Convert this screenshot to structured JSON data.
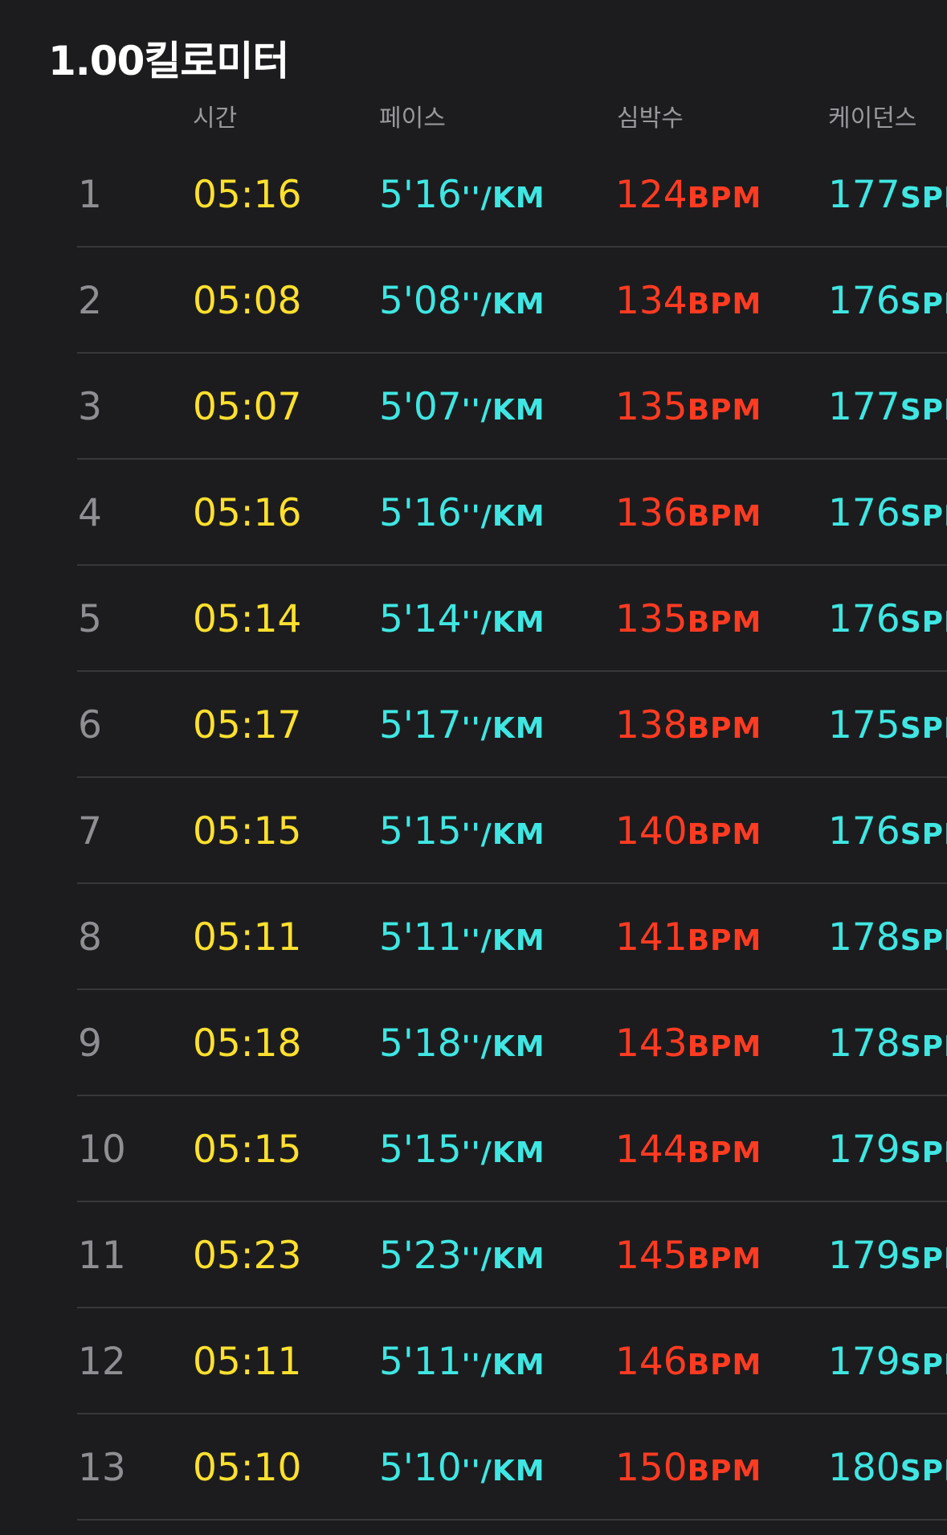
{
  "title": "1.00킬로미터",
  "columns": {
    "time": "시간",
    "pace": "페이스",
    "heart_rate": "심박수",
    "cadence": "케이던스"
  },
  "units": {
    "pace": "''/KM",
    "heart_rate": "BPM",
    "cadence": "SPM"
  },
  "rows": [
    {
      "index": "1",
      "time": "05:16",
      "pace": "5'16",
      "hr": "124",
      "cadence": "177"
    },
    {
      "index": "2",
      "time": "05:08",
      "pace": "5'08",
      "hr": "134",
      "cadence": "176"
    },
    {
      "index": "3",
      "time": "05:07",
      "pace": "5'07",
      "hr": "135",
      "cadence": "177"
    },
    {
      "index": "4",
      "time": "05:16",
      "pace": "5'16",
      "hr": "136",
      "cadence": "176"
    },
    {
      "index": "5",
      "time": "05:14",
      "pace": "5'14",
      "hr": "135",
      "cadence": "176"
    },
    {
      "index": "6",
      "time": "05:17",
      "pace": "5'17",
      "hr": "138",
      "cadence": "175"
    },
    {
      "index": "7",
      "time": "05:15",
      "pace": "5'15",
      "hr": "140",
      "cadence": "176"
    },
    {
      "index": "8",
      "time": "05:11",
      "pace": "5'11",
      "hr": "141",
      "cadence": "178"
    },
    {
      "index": "9",
      "time": "05:18",
      "pace": "5'18",
      "hr": "143",
      "cadence": "178"
    },
    {
      "index": "10",
      "time": "05:15",
      "pace": "5'15",
      "hr": "144",
      "cadence": "179"
    },
    {
      "index": "11",
      "time": "05:23",
      "pace": "5'23",
      "hr": "145",
      "cadence": "179"
    },
    {
      "index": "12",
      "time": "05:11",
      "pace": "5'11",
      "hr": "146",
      "cadence": "179"
    },
    {
      "index": "13",
      "time": "05:10",
      "pace": "5'10",
      "hr": "150",
      "cadence": "180"
    }
  ],
  "colors": {
    "background": "#1c1c1e",
    "time": "#ffe02e",
    "pace": "#3fe6e2",
    "heart_rate": "#ff3b22",
    "cadence": "#3fe6e2",
    "index": "#8e8e93",
    "header": "#98989d"
  }
}
